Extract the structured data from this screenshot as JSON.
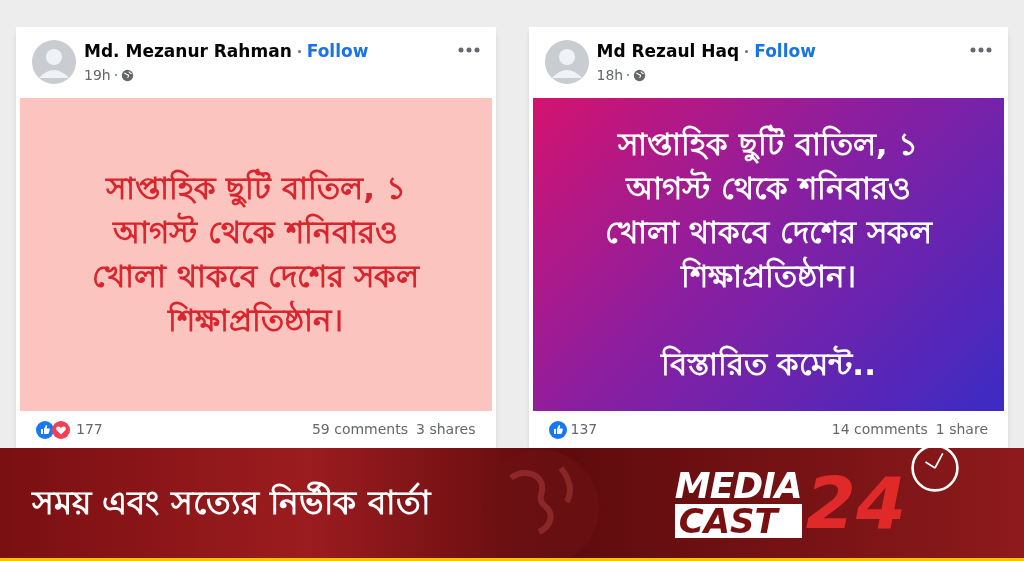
{
  "posts": [
    {
      "author": "Md. Mezanur Rahman",
      "follow": "Follow",
      "time": "19h",
      "kind": "solid",
      "lines": [
        "সাপ্তাহিক ছুটি বাতিল, ১",
        "আগস্ট থেকে শনিবারও",
        "খোলা থাকবে দেশের সকল",
        "শিক্ষাপ্রতিষ্ঠান।"
      ],
      "reactions": [
        {
          "kind": "like"
        },
        {
          "kind": "love"
        }
      ],
      "reaction_count": "177",
      "comments": "59 comments",
      "shares": "3 shares"
    },
    {
      "author": "Md Rezaul Haq",
      "follow": "Follow",
      "time": "18h",
      "kind": "gradient",
      "lines": [
        "সাপ্তাহিক ছুটি বাতিল, ১",
        "আগস্ট থেকে শনিবারও",
        "খোলা থাকবে দেশের সকল",
        "শিক্ষাপ্রতিষ্ঠান।"
      ],
      "note": "বিস্তারিত কমেন্ট..",
      "reactions": [
        {
          "kind": "like"
        }
      ],
      "reaction_count": "137",
      "comments": "14 comments",
      "shares": "1 share"
    }
  ],
  "banner": {
    "slogan": "সময় এবং সত্যের নির্ভীক বার্তা",
    "logo_top": "MEDIA",
    "logo_bottom": "CAST",
    "logo_number": "24"
  }
}
